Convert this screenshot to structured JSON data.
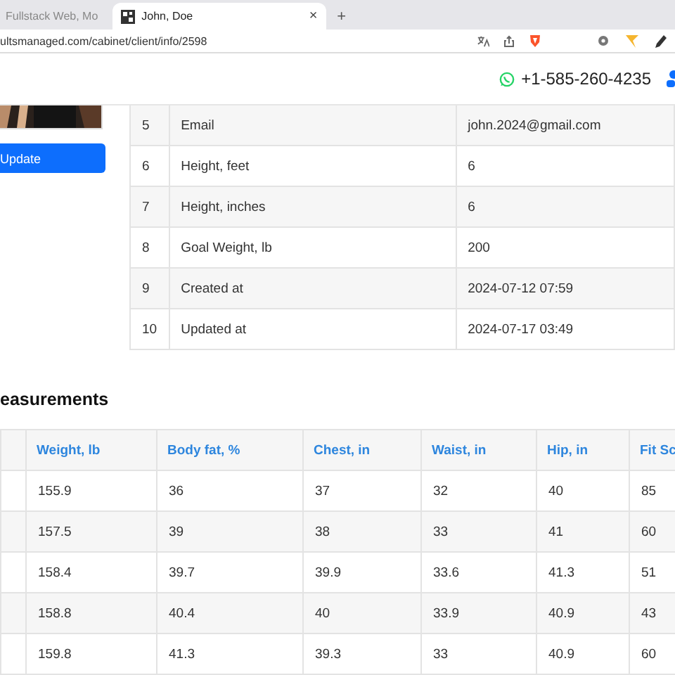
{
  "browser": {
    "tabs": [
      {
        "title": "Fullstack Web, Mo",
        "selected": false
      },
      {
        "title": "John, Doe",
        "selected": true
      }
    ],
    "new_tab": "+",
    "close": "×",
    "url": "ultsmanaged.com/cabinet/client/info/2598"
  },
  "header": {
    "phone": "+1-585-260-4235"
  },
  "profile": {
    "update_button": "Update"
  },
  "info_table": {
    "rows": [
      {
        "index": "5",
        "field": "Email",
        "value": "john.2024@gmail.com"
      },
      {
        "index": "6",
        "field": "Height, feet",
        "value": "6"
      },
      {
        "index": "7",
        "field": "Height, inches",
        "value": "6"
      },
      {
        "index": "8",
        "field": "Goal Weight, lb",
        "value": "200"
      },
      {
        "index": "9",
        "field": "Created at",
        "value": "2024-07-12 07:59"
      },
      {
        "index": "10",
        "field": "Updated at",
        "value": "2024-07-17 03:49"
      }
    ]
  },
  "measurements": {
    "title": "easurements",
    "columns": [
      "Weight, lb",
      "Body fat, %",
      "Chest, in",
      "Waist, in",
      "Hip, in",
      "Fit Sc"
    ],
    "rows": [
      [
        "155.9",
        "36",
        "37",
        "32",
        "40",
        "85"
      ],
      [
        "157.5",
        "39",
        "38",
        "33",
        "41",
        "60"
      ],
      [
        "158.4",
        "39.7",
        "39.9",
        "33.6",
        "41.3",
        "51"
      ],
      [
        "158.8",
        "40.4",
        "40",
        "33.9",
        "40.9",
        "43"
      ],
      [
        "159.8",
        "41.3",
        "39.3",
        "33",
        "40.9",
        "60"
      ]
    ]
  }
}
